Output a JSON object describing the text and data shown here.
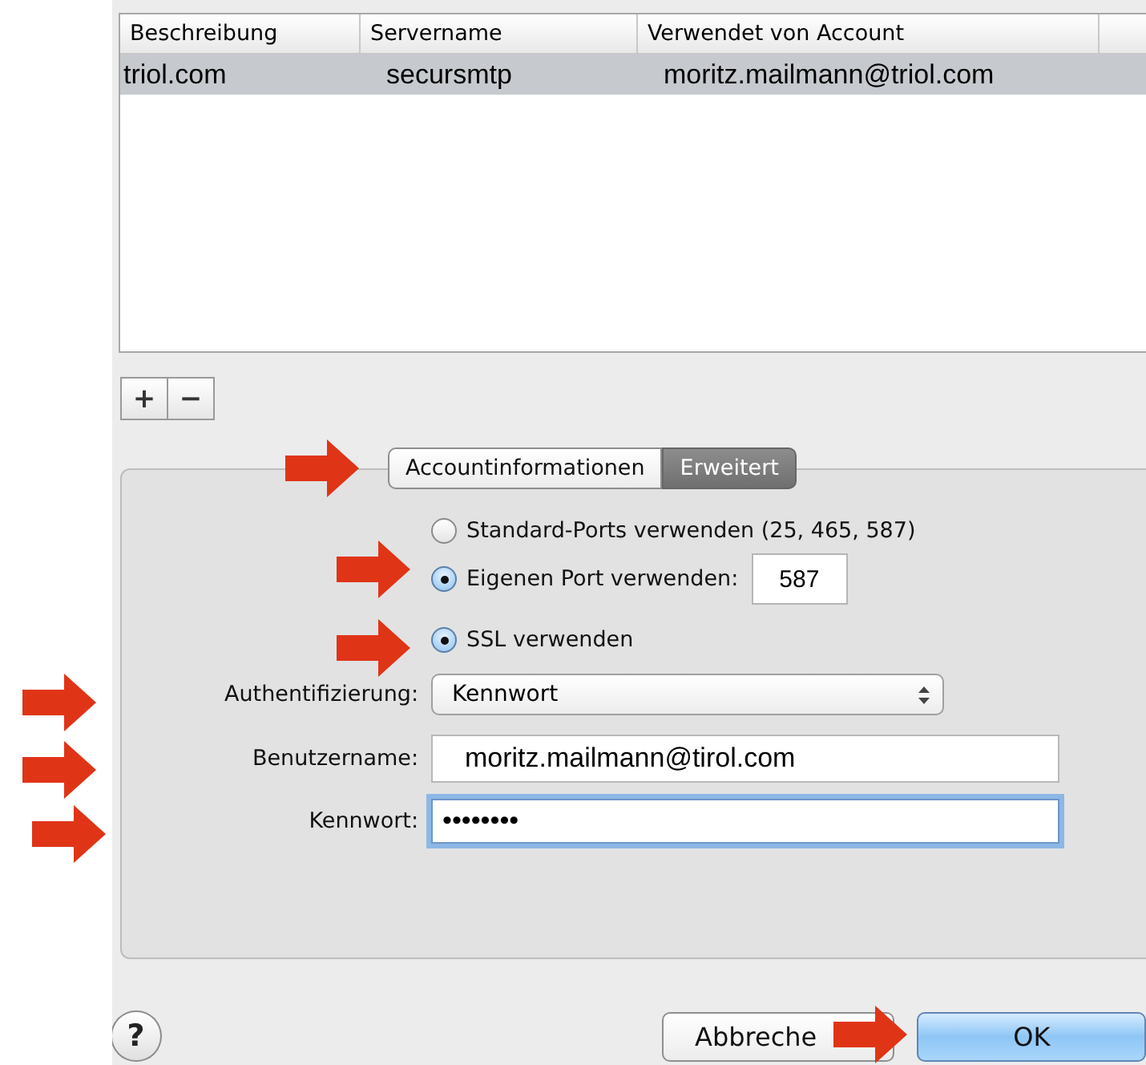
{
  "table": {
    "columns": [
      "Beschreibung",
      "Servername",
      "Verwendet von Account"
    ],
    "rows": [
      {
        "cells": [
          "triol.com",
          "secursmtp",
          "moritz.mailmann@triol.com"
        ],
        "selected": true
      }
    ]
  },
  "list_buttons": [
    "+",
    "−"
  ],
  "tabs": [
    {
      "label": "Accountinformationen",
      "selected": false
    },
    {
      "label": "Erweitert",
      "selected": true
    }
  ],
  "port_options": [
    {
      "label": "Standard-Ports verwenden (25, 465, 587)",
      "selected": false
    },
    {
      "label": "Eigenen Port verwenden:",
      "selected": true
    }
  ],
  "port": {
    "value": "587"
  },
  "ssl": {
    "label": "SSL verwenden",
    "checked": true
  },
  "authentication": {
    "label": "Authentifizierung:",
    "value": "Kennwort"
  },
  "username": {
    "label": "Benutzername:",
    "value": "moritz.mailmann@tirol.com"
  },
  "password": {
    "label": "Kennwort:",
    "value": "••••••••",
    "focused": true
  },
  "help": "?",
  "buttons": [
    {
      "label": "Abbreche",
      "default": false
    },
    {
      "label": "OK",
      "default": true
    }
  ]
}
